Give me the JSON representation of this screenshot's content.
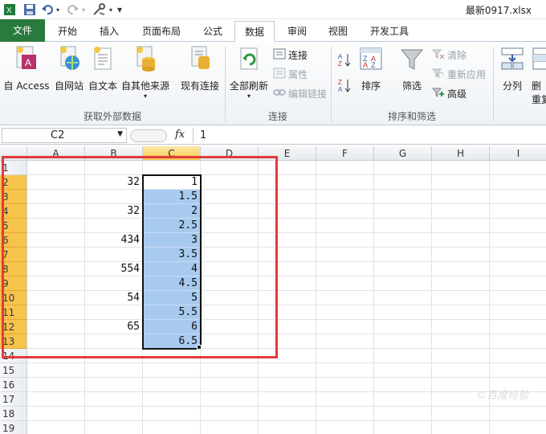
{
  "titlebar": {
    "file_title": "最新0917.xlsx",
    "qa_dropdown": "▾"
  },
  "tabs": [
    {
      "label": "文件"
    },
    {
      "label": "开始"
    },
    {
      "label": "插入"
    },
    {
      "label": "页面布局"
    },
    {
      "label": "公式"
    },
    {
      "label": "数据"
    },
    {
      "label": "审阅"
    },
    {
      "label": "视图"
    },
    {
      "label": "开发工具"
    }
  ],
  "ribbon": {
    "external": {
      "access": "自 Access",
      "web": "自网站",
      "text": "自文本",
      "other": "自其他来源",
      "existing": "现有连接",
      "group": "获取外部数据"
    },
    "connections": {
      "refresh_all": "全部刷新",
      "connections": "连接",
      "properties": "属性",
      "edit_links": "编辑链接",
      "group": "连接"
    },
    "sort_filter": {
      "sort": "排序",
      "filter": "筛选",
      "clear": "清除",
      "reapply": "重新应用",
      "advanced": "高级",
      "group": "排序和筛选"
    },
    "tools": {
      "text_to_columns": "分列",
      "partial_1": "删",
      "partial_2": "重复"
    }
  },
  "formula_bar": {
    "name_box": "C2",
    "fx": "fx",
    "value": "1"
  },
  "sheet": {
    "columns": [
      "A",
      "B",
      "C",
      "D",
      "E",
      "F",
      "G",
      "H",
      "I"
    ],
    "rows": [
      "1",
      "2",
      "3",
      "4",
      "5",
      "6",
      "7",
      "8",
      "9",
      "10",
      "11",
      "12",
      "13",
      "14",
      "15",
      "16",
      "17",
      "18",
      "19"
    ],
    "column_b": [
      "",
      "32",
      "",
      "32",
      "",
      "434",
      "",
      "554",
      "",
      "54",
      "",
      "65",
      ""
    ],
    "column_c": [
      "",
      "1",
      "1.5",
      "2",
      "2.5",
      "3",
      "3.5",
      "4",
      "4.5",
      "5",
      "5.5",
      "6",
      "6.5"
    ],
    "active_cell": "C2",
    "selection": "C2:C13"
  },
  "colors": {
    "file_tab": "#2b7a3d",
    "selection_fill": "#a8caef",
    "header_highlight": "#f8c34a",
    "annotation": "#e23b3b"
  },
  "watermark": "©百度经验"
}
